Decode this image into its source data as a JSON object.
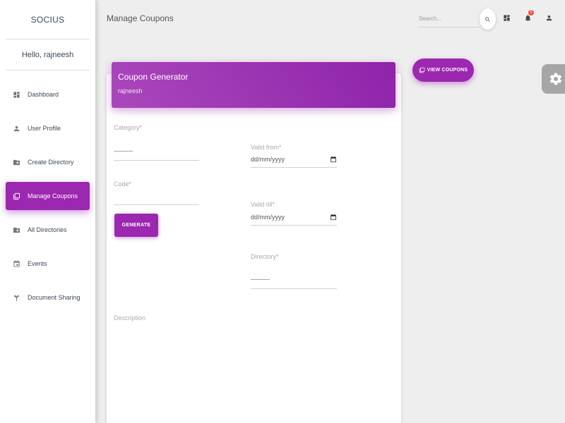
{
  "brand": "SOCIUS",
  "greeting": "Hello, rajneesh",
  "page_title": "Manage Coupons",
  "search": {
    "placeholder": "Search..."
  },
  "notifications": {
    "count": "5"
  },
  "sidebar": {
    "items": [
      {
        "label": "Dashboard",
        "icon": "dashboard-icon"
      },
      {
        "label": "User Profile",
        "icon": "person-icon"
      },
      {
        "label": "Create Directory",
        "icon": "folder-add-icon"
      },
      {
        "label": "Manage Coupons",
        "icon": "library-icon",
        "active": true
      },
      {
        "label": "All Directories",
        "icon": "folder-add-icon"
      },
      {
        "label": "Events",
        "icon": "calendar-icon"
      },
      {
        "label": "Document Sharing",
        "icon": "share-icon"
      }
    ]
  },
  "card": {
    "title": "Coupon Generator",
    "subtitle": "rajneesh"
  },
  "form": {
    "category_label": "Category*",
    "category_value": "---------",
    "code_label": "Code*",
    "code_value": "",
    "generate_label": "GENERATE",
    "valid_from_label": "Valid from*",
    "valid_from_value": "dd/mm/yyyy",
    "valid_till_label": "Valid till*",
    "valid_till_value": "dd/mm/yyyy",
    "directory_label": "Directory*",
    "directory_value": "---------",
    "description_label": "Description"
  },
  "view_coupons_label": "VIEW COUPONS",
  "colors": {
    "accent": "#9c27b0",
    "accent_dark": "#8e24aa",
    "badge": "#f44336"
  }
}
